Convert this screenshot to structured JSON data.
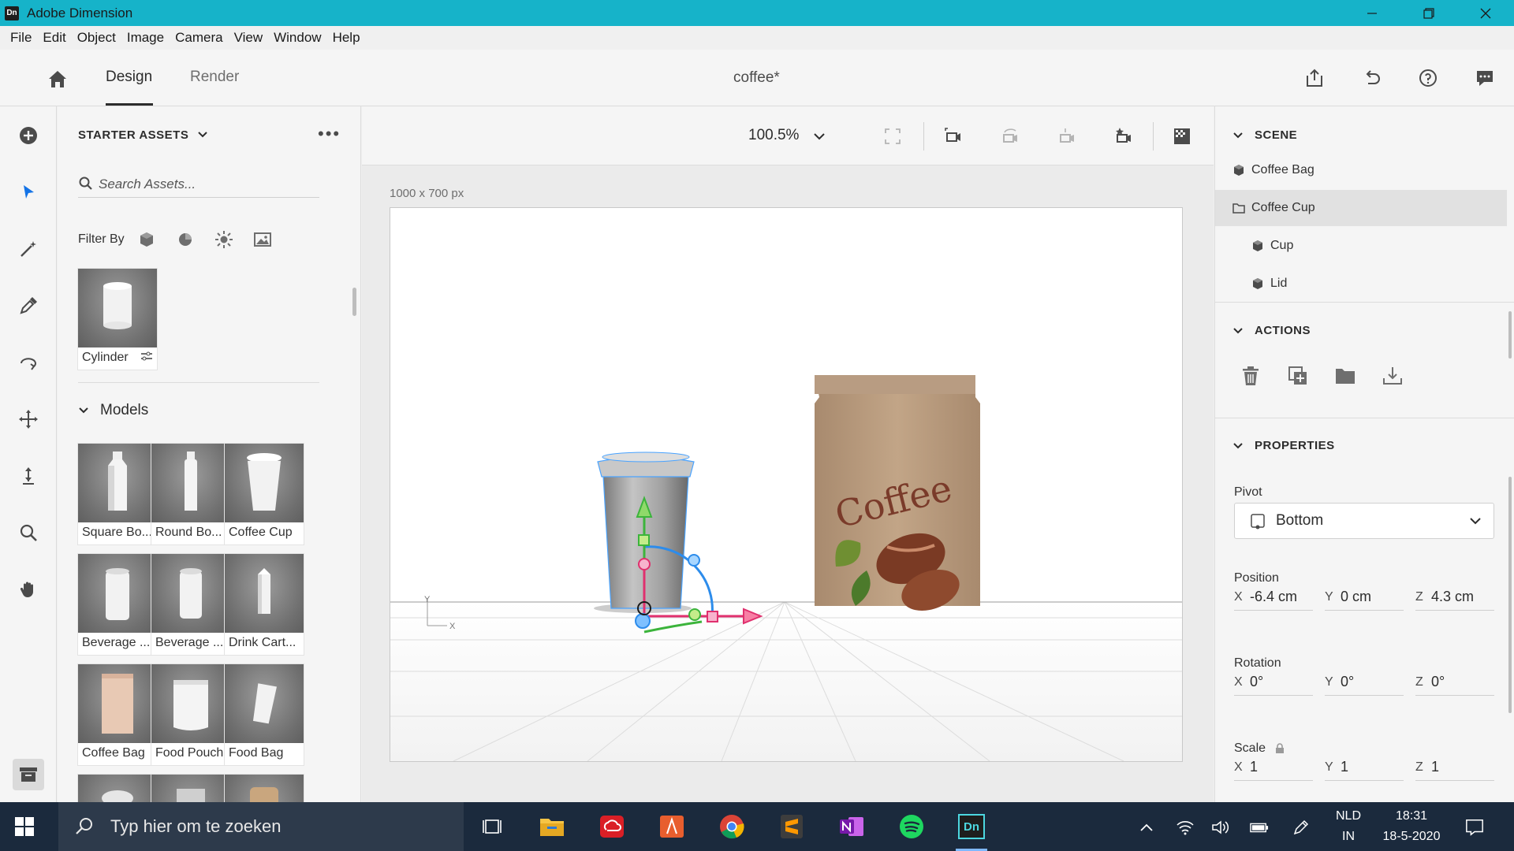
{
  "window": {
    "app_badge": "Dn",
    "title": "Adobe Dimension",
    "controls": [
      "minimize",
      "restore",
      "close"
    ]
  },
  "menu": [
    "File",
    "Edit",
    "Object",
    "Image",
    "Camera",
    "View",
    "Window",
    "Help"
  ],
  "header": {
    "tabs": [
      {
        "label": "Design",
        "active": true
      },
      {
        "label": "Render",
        "active": false
      }
    ],
    "document_title": "coffee*",
    "icons": [
      "share-icon",
      "undo-icon",
      "help-icon",
      "feedback-icon"
    ]
  },
  "tools": [
    "add-icon",
    "select-icon",
    "magic-wand-icon",
    "eyedropper-icon",
    "orbit-icon",
    "pan-icon",
    "dolly-icon",
    "zoom-icon",
    "hand-icon"
  ],
  "assets": {
    "heading": "STARTER ASSETS",
    "more": "•••",
    "search_placeholder": "Search Assets...",
    "filter_label": "Filter By",
    "filters": [
      "models-filter-icon",
      "materials-filter-icon",
      "lights-filter-icon",
      "images-filter-icon"
    ],
    "top_item": "Cylinder",
    "models_heading": "Models",
    "models": [
      "Square Bo...",
      "Round Bo...",
      "Coffee Cup",
      "Beverage ...",
      "Beverage ...",
      "Drink Cart...",
      "Coffee Bag",
      "Food Pouch",
      "Food Bag"
    ]
  },
  "canvas": {
    "zoom": "100.5%",
    "size_label": "1000 x 700 px",
    "axis_y": "Y",
    "axis_x": "X",
    "bag_text": "Coffee",
    "toolbar_icons": [
      "frame-icon",
      "camera-fit-icon",
      "camera-rotate-icon",
      "camera-move-icon",
      "camera-bookmark-icon",
      "render-preview-icon"
    ]
  },
  "scene": {
    "heading": "SCENE",
    "items": [
      {
        "label": "Coffee Bag",
        "level": 0,
        "type": "model",
        "selected": false
      },
      {
        "label": "Coffee Cup",
        "level": 0,
        "type": "group",
        "selected": true
      },
      {
        "label": "Cup",
        "level": 1,
        "type": "model",
        "selected": false
      },
      {
        "label": "Lid",
        "level": 1,
        "type": "model",
        "selected": false
      }
    ]
  },
  "actions": {
    "heading": "ACTIONS",
    "icons": [
      "delete-icon",
      "duplicate-icon",
      "group-icon",
      "place-on-ground-icon"
    ]
  },
  "properties": {
    "heading": "PROPERTIES",
    "pivot_label": "Pivot",
    "pivot_value": "Bottom",
    "position_label": "Position",
    "position": {
      "x": "-6.4 cm",
      "y": "0 cm",
      "z": "4.3 cm"
    },
    "rotation_label": "Rotation",
    "rotation": {
      "x": "0°",
      "y": "0°",
      "z": "0°"
    },
    "scale_label": "Scale",
    "scale": {
      "x": "1",
      "y": "1",
      "z": "1"
    },
    "axis_labels": {
      "x": "X",
      "y": "Y",
      "z": "Z"
    }
  },
  "taskbar": {
    "search_placeholder": "Typ hier om te zoeken",
    "apps": [
      "task-view-icon",
      "file-explorer-icon",
      "creative-cloud-icon",
      "illustrator-draw-icon",
      "chrome-icon",
      "sublime-icon",
      "onenote-icon",
      "spotify-icon",
      "dimension-icon"
    ],
    "dimension_badge": "Dn",
    "language": "NLD",
    "language_sub": "IN",
    "time": "18:31",
    "date": "18-5-2020"
  },
  "colors": {
    "titlebar": "#16b3c9",
    "accent_blue": "#1473e6",
    "taskbar": "#1b2a3d"
  }
}
